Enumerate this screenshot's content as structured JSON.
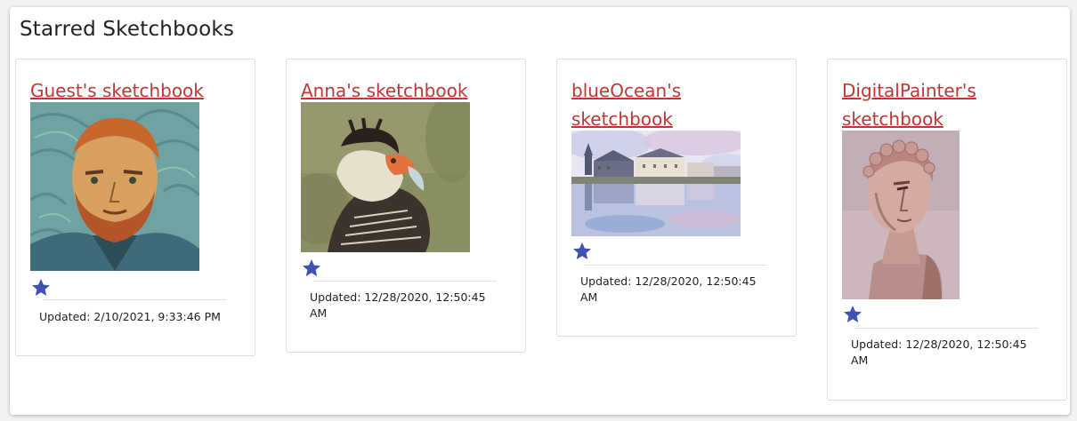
{
  "section": {
    "title": "Starred Sketchbooks"
  },
  "colors": {
    "link": "#c43533",
    "star": "#3f51b5",
    "panel_bg": "#ffffff",
    "page_bg": "#f2f2f2"
  },
  "cards": [
    {
      "title": "Guest's sketchbook",
      "thumbnail": "van-gogh-self-portrait",
      "starred": true,
      "updated": "Updated: 2/10/2021, 9:33:46 PM"
    },
    {
      "title": "Anna's sketchbook",
      "thumbnail": "caracara-bird",
      "starred": true,
      "updated": "Updated: 12/28/2020, 12:50:45 AM"
    },
    {
      "title": "blueOcean's sketchbook",
      "thumbnail": "waterfront-watercolor",
      "starred": true,
      "updated": "Updated: 12/28/2020, 12:50:45 AM"
    },
    {
      "title": "DigitalPainter's sketchbook",
      "thumbnail": "classical-bust",
      "starred": true,
      "updated": "Updated: 12/28/2020, 12:50:45 AM"
    }
  ]
}
